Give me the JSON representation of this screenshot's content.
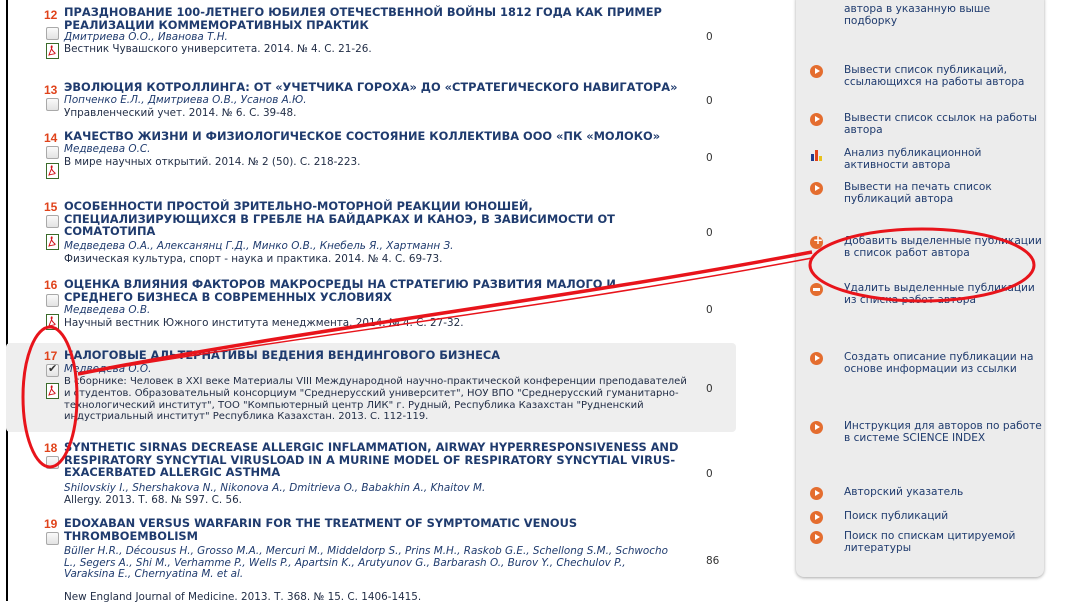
{
  "publications": [
    {
      "num": "12",
      "title": "ПРАЗДНОВАНИЕ 100-ЛЕТНЕГО ЮБИЛЕЯ ОТЕЧЕСТВЕННОЙ ВОЙНЫ 1812 ГОДА КАК ПРИМЕР РЕАЛИЗАЦИИ КОММЕМОРАТИВНЫХ ПРАКТИК",
      "authors": "Дмитриева О.О., Иванова Т.Н.",
      "source": "Вестник Чувашского университета. 2014. № 4. С. 21-26.",
      "cites": "0",
      "checked": false
    },
    {
      "num": "13",
      "title": "ЭВОЛЮЦИЯ КОТРОЛЛИНГА: ОТ «УЧЕТЧИКА ГОРОХА» ДО «СТРАТЕГИЧЕСКОГО НАВИГАТОРА»",
      "authors": "Попченко Е.Л., Дмитриева О.В., Усанов А.Ю.",
      "source": "Управленческий учет. 2014. № 6. С. 39-48.",
      "cites": "0",
      "checked": false
    },
    {
      "num": "14",
      "title": "КАЧЕСТВО ЖИЗНИ И ФИЗИОЛОГИЧЕСКОЕ СОСТОЯНИЕ КОЛЛЕКТИВА ООО «ПК «МОЛОКО»",
      "authors": "Медведева О.С.",
      "source": "В мире научных открытий. 2014. № 2 (50). С. 218-223.",
      "cites": "0",
      "checked": false
    },
    {
      "num": "15",
      "title": "ОСОБЕННОСТИ ПРОСТОЙ ЗРИТЕЛЬНО-МОТОРНОЙ РЕАКЦИИ ЮНОШЕЙ, СПЕЦИАЛИЗИРУЮЩИХСЯ В ГРЕБЛЕ НА БАЙДАРКАХ И КАНОЭ, В ЗАВИСИМОСТИ ОТ СОМАТОТИПА",
      "authors": "Медведева О.А., Алексанянц Г.Д., Минко О.В., Кнебель Я., Хартманн З.",
      "source": "Физическая культура, спорт - наука и практика. 2014. № 4. С. 69-73.",
      "cites": "0",
      "checked": false
    },
    {
      "num": "16",
      "title": "ОЦЕНКА ВЛИЯНИЯ ФАКТОРОВ МАКРОСРЕДЫ НА СТРАТЕГИЮ РАЗВИТИЯ МАЛОГО И СРЕДНЕГО БИЗНЕСА В СОВРЕМЕННЫХ УСЛОВИЯХ",
      "authors": "Медведева О.В.",
      "source": "Научный вестник Южного института менеджмента. 2014. № 4. С. 27-32.",
      "cites": "0",
      "checked": false
    },
    {
      "num": "17",
      "title": "НАЛОГОВЫЕ АЛЬТЕРНАТИВЫ ВЕДЕНИЯ ВЕНДИНГОВОГО БИЗНЕСА",
      "authors": "Медведева О.О.",
      "source": "В сборнике: Человек в XXI веке Материалы VIII Международной научно-практической конференции преподавателей и студентов. Образовательный консорциум \"Среднерусский университет\", НОУ ВПО \"Среднерусский гуманитарно-технологический институт\", ТОО \"Компьютерный центр ЛИК\" г. Рудный, Республика Казахстан \"Рудненский индустриальный институт\" Республика Казахстан. 2013. С. 112-119.",
      "cites": "0",
      "checked": true
    },
    {
      "num": "18",
      "title": "SYNTHETIC SIRNAS DECREASE ALLERGIC INFLAMMATION, AIRWAY HYPERRESPONSIVENESS AND RESPIRATORY SYNCYTIAL VIRUSLOAD IN A MURINE MODEL OF RESPIRATORY SYNCYTIAL VIRUS-EXACERBATED ALLERGIC ASTHMA",
      "authors": "Shilovskiy I., Shershakova N., Nikonova A., Dmitrieva O., Babakhin A., Khaitov M.",
      "source": "Allergy. 2013. Т. 68. № S97. С. 56.",
      "cites": "0",
      "checked": false
    },
    {
      "num": "19",
      "title": "EDOXABAN VERSUS WARFARIN FOR THE TREATMENT OF SYMPTOMATIC VENOUS THROMBOEMBOLISM",
      "authors": "Büller H.R., Décousus H., Grosso M.A., Mercuri M., Middeldorp S., Prins M.H., Raskob G.E., Schellong S.M., Schwocho L., Segers A., Shi M., Verhamme P., Wells P., Apartsin K., Arutyunov G., Barbarash O., Burov Y., Chechulov P., Varaksina E., Chernyatina M. et al.",
      "source": "New England Journal of Medicine. 2013. Т. 368. № 15. С. 1406-1415.",
      "cites": "86",
      "checked": false
    }
  ],
  "sidebar": {
    "items": [
      {
        "label": "автора в указанную выше подборку",
        "icon": "none"
      },
      {
        "label": "Вывести список публикаций, ссылающихся на работы автора",
        "icon": "play-icon"
      },
      {
        "label": "Вывести список ссылок на работы автора",
        "icon": "play-icon"
      },
      {
        "label": "Анализ публикационной активности автора",
        "icon": "bar-chart-icon"
      },
      {
        "label": "Вывести на печать список публикаций автора",
        "icon": "play-icon"
      },
      {
        "label": "Добавить выделенные публикации в список работ автора",
        "icon": "plus-icon"
      },
      {
        "label": "Удалить выделенные публикации из списка работ автора",
        "icon": "minus-icon"
      },
      {
        "label": "Создать описание публикации на основе информации из ссылки",
        "icon": "play-icon"
      },
      {
        "label": "Инструкция для авторов по работе в системе SCIENCE INDEX",
        "icon": "play-icon"
      },
      {
        "label": "Авторский указатель",
        "icon": "play-icon"
      },
      {
        "label": "Поиск публикаций",
        "icon": "play-icon"
      },
      {
        "label": "Поиск по спискам цитируемой литературы",
        "icon": "play-icon"
      }
    ]
  },
  "colors": {
    "number": "#e0431b",
    "title": "#1f3b6e",
    "sidebar_icon": "#e46d2f",
    "annotation": "#e8141b",
    "selected_row_bg": "#eeeeee"
  }
}
